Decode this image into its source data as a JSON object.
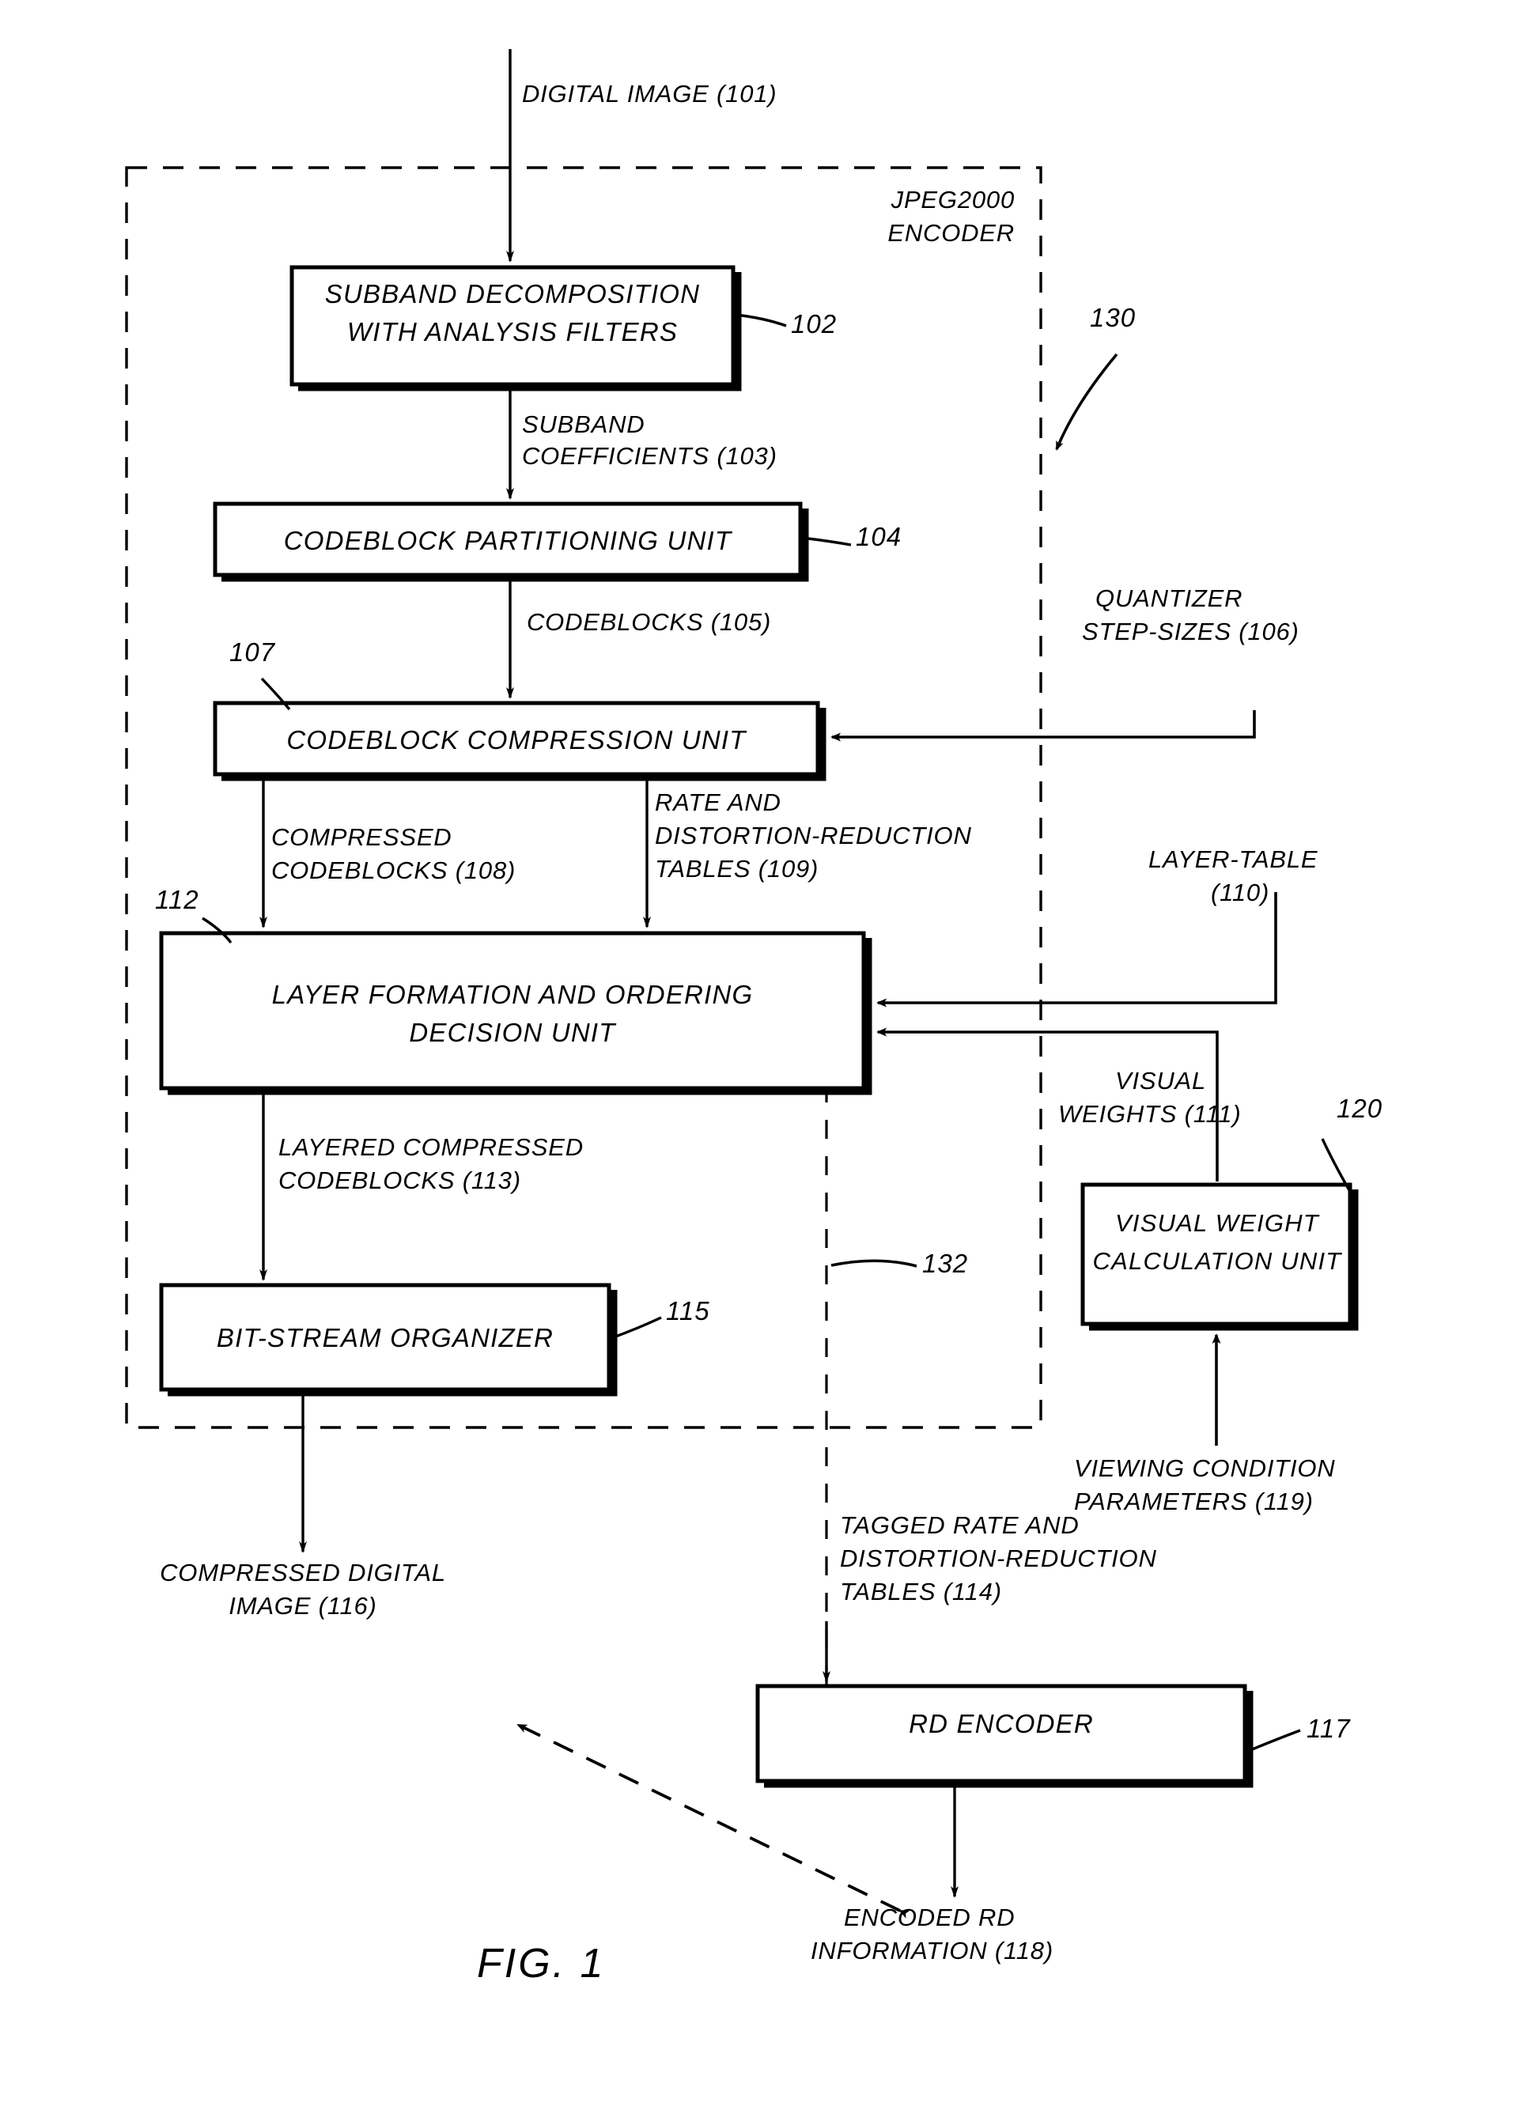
{
  "figure": {
    "caption": "FIG. 1",
    "title_note": "JPEG2000 ENCODER"
  },
  "boundaries": [
    {
      "id": "130",
      "label": "130",
      "note": "dashed boundary of JPEG2000 encoder"
    },
    {
      "id": "132",
      "label": "132",
      "note": "dashed vertical divider"
    }
  ],
  "encoder_label": {
    "line1": "JPEG2000",
    "line2": "ENCODER"
  },
  "blocks": [
    {
      "ref": "102",
      "line1": "SUBBAND DECOMPOSITION",
      "line2": "WITH ANALYSIS FILTERS"
    },
    {
      "ref": "104",
      "line1": "CODEBLOCK PARTITIONING UNIT",
      "line2": ""
    },
    {
      "ref": "107",
      "line1": "CODEBLOCK COMPRESSION UNIT",
      "line2": ""
    },
    {
      "ref": "112",
      "line1": "LAYER FORMATION AND ORDERING",
      "line2": "DECISION UNIT"
    },
    {
      "ref": "115",
      "line1": "BIT-STREAM ORGANIZER",
      "line2": ""
    },
    {
      "ref": "120",
      "line1": "VISUAL WEIGHT",
      "line2": "CALCULATION UNIT"
    },
    {
      "ref": "117",
      "line1": "RD ENCODER",
      "line2": ""
    }
  ],
  "flow_labels": [
    {
      "ref": "101",
      "line1": "DIGITAL IMAGE (101)",
      "line2": ""
    },
    {
      "ref": "103",
      "line1": "SUBBAND",
      "line2": "COEFFICIENTS (103)"
    },
    {
      "ref": "105",
      "line1": "CODEBLOCKS (105)",
      "line2": ""
    },
    {
      "ref": "106",
      "line1": "QUANTIZER",
      "line2": "STEP-SIZES (106)"
    },
    {
      "ref": "108",
      "line1": "COMPRESSED",
      "line2": "CODEBLOCKS (108)"
    },
    {
      "ref": "109",
      "line1": "RATE AND",
      "line2": "DISTORTION-REDUCTION",
      "line3": "TABLES (109)"
    },
    {
      "ref": "110",
      "line1": "LAYER-TABLE",
      "line2": "(110)"
    },
    {
      "ref": "111",
      "line1": "VISUAL",
      "line2": "WEIGHTS (111)"
    },
    {
      "ref": "113",
      "line1": "LAYERED COMPRESSED",
      "line2": "CODEBLOCKS (113)"
    },
    {
      "ref": "119",
      "line1": "VIEWING CONDITION",
      "line2": "PARAMETERS (119)"
    },
    {
      "ref": "116",
      "line1": "COMPRESSED DIGITAL",
      "line2": "IMAGE (116)"
    },
    {
      "ref": "114",
      "line1": "TAGGED RATE AND",
      "line2": "DISTORTION-REDUCTION",
      "line3": "TABLES (114)"
    },
    {
      "ref": "118",
      "line1": "ENCODED RD",
      "line2": "INFORMATION (118)"
    }
  ],
  "ref_numbers": {
    "n102": "102",
    "n104": "104",
    "n107": "107",
    "n112": "112",
    "n115": "115",
    "n117": "117",
    "n120": "120",
    "n130": "130",
    "n132": "132"
  },
  "colors": {
    "ink": "#000000",
    "paper": "#ffffff"
  }
}
